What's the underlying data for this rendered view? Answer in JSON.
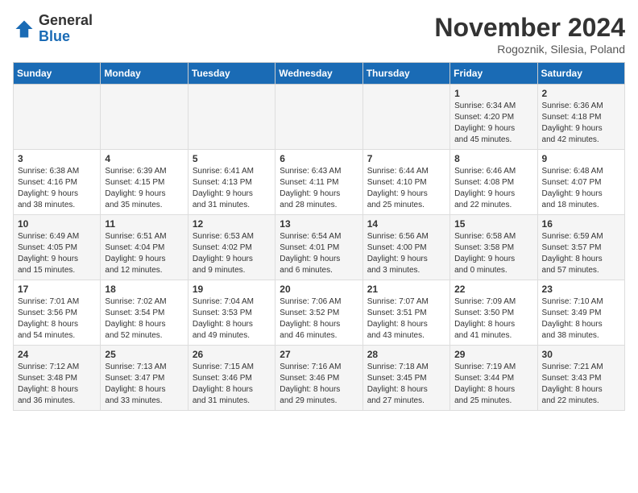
{
  "logo": {
    "general": "General",
    "blue": "Blue"
  },
  "header": {
    "month_year": "November 2024",
    "location": "Rogoznik, Silesia, Poland"
  },
  "weekdays": [
    "Sunday",
    "Monday",
    "Tuesday",
    "Wednesday",
    "Thursday",
    "Friday",
    "Saturday"
  ],
  "weeks": [
    [
      {
        "day": "",
        "info": ""
      },
      {
        "day": "",
        "info": ""
      },
      {
        "day": "",
        "info": ""
      },
      {
        "day": "",
        "info": ""
      },
      {
        "day": "",
        "info": ""
      },
      {
        "day": "1",
        "info": "Sunrise: 6:34 AM\nSunset: 4:20 PM\nDaylight: 9 hours\nand 45 minutes."
      },
      {
        "day": "2",
        "info": "Sunrise: 6:36 AM\nSunset: 4:18 PM\nDaylight: 9 hours\nand 42 minutes."
      }
    ],
    [
      {
        "day": "3",
        "info": "Sunrise: 6:38 AM\nSunset: 4:16 PM\nDaylight: 9 hours\nand 38 minutes."
      },
      {
        "day": "4",
        "info": "Sunrise: 6:39 AM\nSunset: 4:15 PM\nDaylight: 9 hours\nand 35 minutes."
      },
      {
        "day": "5",
        "info": "Sunrise: 6:41 AM\nSunset: 4:13 PM\nDaylight: 9 hours\nand 31 minutes."
      },
      {
        "day": "6",
        "info": "Sunrise: 6:43 AM\nSunset: 4:11 PM\nDaylight: 9 hours\nand 28 minutes."
      },
      {
        "day": "7",
        "info": "Sunrise: 6:44 AM\nSunset: 4:10 PM\nDaylight: 9 hours\nand 25 minutes."
      },
      {
        "day": "8",
        "info": "Sunrise: 6:46 AM\nSunset: 4:08 PM\nDaylight: 9 hours\nand 22 minutes."
      },
      {
        "day": "9",
        "info": "Sunrise: 6:48 AM\nSunset: 4:07 PM\nDaylight: 9 hours\nand 18 minutes."
      }
    ],
    [
      {
        "day": "10",
        "info": "Sunrise: 6:49 AM\nSunset: 4:05 PM\nDaylight: 9 hours\nand 15 minutes."
      },
      {
        "day": "11",
        "info": "Sunrise: 6:51 AM\nSunset: 4:04 PM\nDaylight: 9 hours\nand 12 minutes."
      },
      {
        "day": "12",
        "info": "Sunrise: 6:53 AM\nSunset: 4:02 PM\nDaylight: 9 hours\nand 9 minutes."
      },
      {
        "day": "13",
        "info": "Sunrise: 6:54 AM\nSunset: 4:01 PM\nDaylight: 9 hours\nand 6 minutes."
      },
      {
        "day": "14",
        "info": "Sunrise: 6:56 AM\nSunset: 4:00 PM\nDaylight: 9 hours\nand 3 minutes."
      },
      {
        "day": "15",
        "info": "Sunrise: 6:58 AM\nSunset: 3:58 PM\nDaylight: 9 hours\nand 0 minutes."
      },
      {
        "day": "16",
        "info": "Sunrise: 6:59 AM\nSunset: 3:57 PM\nDaylight: 8 hours\nand 57 minutes."
      }
    ],
    [
      {
        "day": "17",
        "info": "Sunrise: 7:01 AM\nSunset: 3:56 PM\nDaylight: 8 hours\nand 54 minutes."
      },
      {
        "day": "18",
        "info": "Sunrise: 7:02 AM\nSunset: 3:54 PM\nDaylight: 8 hours\nand 52 minutes."
      },
      {
        "day": "19",
        "info": "Sunrise: 7:04 AM\nSunset: 3:53 PM\nDaylight: 8 hours\nand 49 minutes."
      },
      {
        "day": "20",
        "info": "Sunrise: 7:06 AM\nSunset: 3:52 PM\nDaylight: 8 hours\nand 46 minutes."
      },
      {
        "day": "21",
        "info": "Sunrise: 7:07 AM\nSunset: 3:51 PM\nDaylight: 8 hours\nand 43 minutes."
      },
      {
        "day": "22",
        "info": "Sunrise: 7:09 AM\nSunset: 3:50 PM\nDaylight: 8 hours\nand 41 minutes."
      },
      {
        "day": "23",
        "info": "Sunrise: 7:10 AM\nSunset: 3:49 PM\nDaylight: 8 hours\nand 38 minutes."
      }
    ],
    [
      {
        "day": "24",
        "info": "Sunrise: 7:12 AM\nSunset: 3:48 PM\nDaylight: 8 hours\nand 36 minutes."
      },
      {
        "day": "25",
        "info": "Sunrise: 7:13 AM\nSunset: 3:47 PM\nDaylight: 8 hours\nand 33 minutes."
      },
      {
        "day": "26",
        "info": "Sunrise: 7:15 AM\nSunset: 3:46 PM\nDaylight: 8 hours\nand 31 minutes."
      },
      {
        "day": "27",
        "info": "Sunrise: 7:16 AM\nSunset: 3:46 PM\nDaylight: 8 hours\nand 29 minutes."
      },
      {
        "day": "28",
        "info": "Sunrise: 7:18 AM\nSunset: 3:45 PM\nDaylight: 8 hours\nand 27 minutes."
      },
      {
        "day": "29",
        "info": "Sunrise: 7:19 AM\nSunset: 3:44 PM\nDaylight: 8 hours\nand 25 minutes."
      },
      {
        "day": "30",
        "info": "Sunrise: 7:21 AM\nSunset: 3:43 PM\nDaylight: 8 hours\nand 22 minutes."
      }
    ]
  ]
}
